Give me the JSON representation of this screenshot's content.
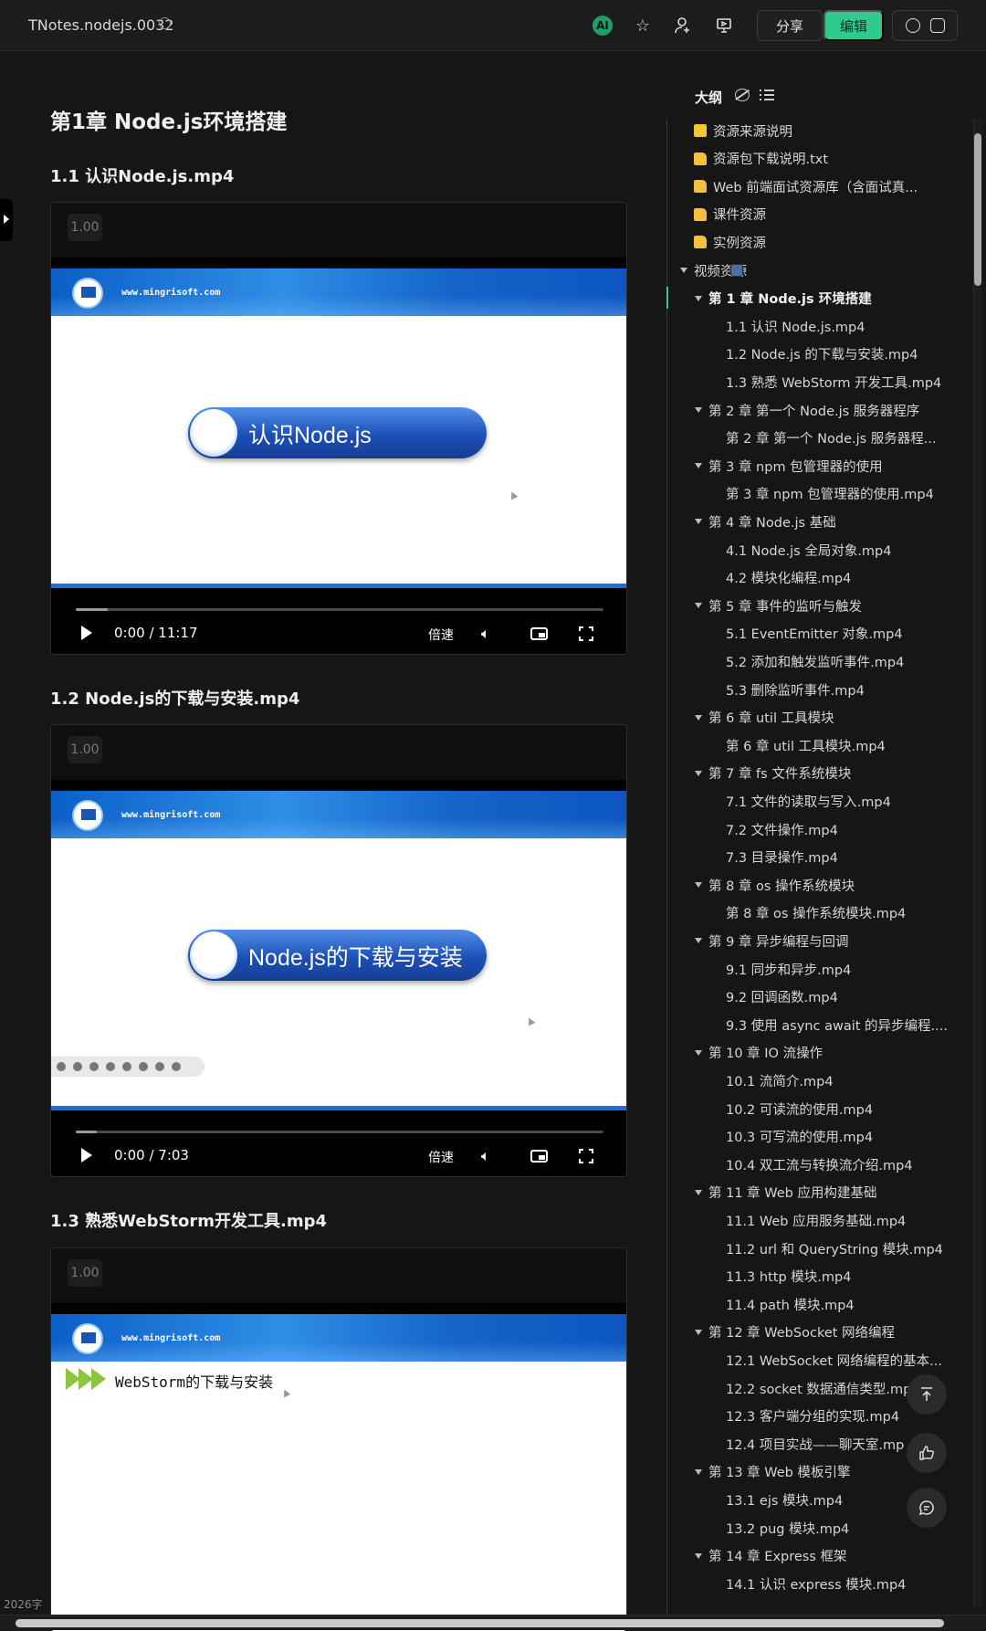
{
  "header": {
    "doc_title": "TNotes.nodejs.0032",
    "ai_label": "AI",
    "share_label": "分享",
    "edit_label": "编辑"
  },
  "doc": {
    "chapter_title": "第1章  Node.js环境搭建",
    "sections": [
      {
        "heading": "1.1  认识Node.js.mp4",
        "speed_value": "1.00",
        "site_text": "www.mingrisoft.com",
        "slide_title": "认识Node.js",
        "time": "0:00 / 11:17",
        "progress_fraction": 0.06,
        "speed_button": "倍速"
      },
      {
        "heading": "1.2  Node.js的下载与安装.mp4",
        "speed_value": "1.00",
        "site_text": "www.mingrisoft.com",
        "slide_title": "Node.js的下载与安装",
        "time": "0:00 / 7:03",
        "progress_fraction": 0.04,
        "speed_button": "倍速"
      },
      {
        "heading": "1.3  熟悉WebStorm开发工具.mp4",
        "speed_value": "1.00",
        "site_text": "www.mingrisoft.com",
        "slide_title": "WebStorm的下载与安装"
      }
    ],
    "word_count": "2026字"
  },
  "outline": {
    "title": "大纲",
    "items": [
      {
        "label": "资源来源说明",
        "level": 0,
        "icon": "note-icon",
        "caret": false
      },
      {
        "label": "资源包下载说明.txt",
        "level": 0,
        "icon": "folder-icon",
        "caret": false
      },
      {
        "label": "Web 前端面试资源库（含面试真...",
        "level": 0,
        "icon": "folder-icon",
        "caret": false
      },
      {
        "label": "课件资源",
        "level": 0,
        "icon": "folder-icon",
        "caret": false
      },
      {
        "label": "实例资源",
        "level": 0,
        "icon": "folder-icon",
        "caret": false
      },
      {
        "label": "视频资源",
        "level": 0,
        "icon": "video-icon",
        "caret": true
      },
      {
        "label": "第 1 章  Node.js 环境搭建",
        "level": 1,
        "caret": true,
        "bold": true
      },
      {
        "label": "1.1  认识 Node.js.mp4",
        "level": 2
      },
      {
        "label": "1.2  Node.js 的下载与安装.mp4",
        "level": 2
      },
      {
        "label": "1.3  熟悉 WebStorm 开发工具.mp4",
        "level": 2
      },
      {
        "label": "第 2 章  第一个 Node.js 服务器程序",
        "level": 1,
        "caret": true
      },
      {
        "label": "第 2 章  第一个 Node.js 服务器程...",
        "level": 2
      },
      {
        "label": "第 3 章  npm 包管理器的使用",
        "level": 1,
        "caret": true
      },
      {
        "label": "第 3 章  npm 包管理器的使用.mp4",
        "level": 2
      },
      {
        "label": "第 4 章  Node.js 基础",
        "level": 1,
        "caret": true
      },
      {
        "label": "4.1  Node.js 全局对象.mp4",
        "level": 2
      },
      {
        "label": "4.2  模块化编程.mp4",
        "level": 2
      },
      {
        "label": "第 5 章  事件的监听与触发",
        "level": 1,
        "caret": true
      },
      {
        "label": "5.1  EventEmitter 对象.mp4",
        "level": 2
      },
      {
        "label": "5.2  添加和触发监听事件.mp4",
        "level": 2
      },
      {
        "label": "5.3  删除监听事件.mp4",
        "level": 2
      },
      {
        "label": "第 6 章  util 工具模块",
        "level": 1,
        "caret": true
      },
      {
        "label": "第 6 章  util 工具模块.mp4",
        "level": 2
      },
      {
        "label": "第 7 章  fs 文件系统模块",
        "level": 1,
        "caret": true
      },
      {
        "label": "7.1  文件的读取与写入.mp4",
        "level": 2
      },
      {
        "label": "7.2  文件操作.mp4",
        "level": 2
      },
      {
        "label": "7.3  目录操作.mp4",
        "level": 2
      },
      {
        "label": "第 8 章  os 操作系统模块",
        "level": 1,
        "caret": true
      },
      {
        "label": "第 8 章  os 操作系统模块.mp4",
        "level": 2
      },
      {
        "label": "第 9 章  异步编程与回调",
        "level": 1,
        "caret": true
      },
      {
        "label": "9.1  同步和异步.mp4",
        "level": 2
      },
      {
        "label": "9.2  回调函数.mp4",
        "level": 2
      },
      {
        "label": "9.3  使用 async await 的异步编程....",
        "level": 2
      },
      {
        "label": "第 10 章  IO 流操作",
        "level": 1,
        "caret": true
      },
      {
        "label": "10.1  流简介.mp4",
        "level": 2
      },
      {
        "label": "10.2  可读流的使用.mp4",
        "level": 2
      },
      {
        "label": "10.3  可写流的使用.mp4",
        "level": 2
      },
      {
        "label": "10.4  双工流与转换流介绍.mp4",
        "level": 2
      },
      {
        "label": "第 11 章  Web 应用构建基础",
        "level": 1,
        "caret": true
      },
      {
        "label": "11.1  Web 应用服务基础.mp4",
        "level": 2
      },
      {
        "label": "11.2  url 和 QueryString 模块.mp4",
        "level": 2
      },
      {
        "label": "11.3  http 模块.mp4",
        "level": 2
      },
      {
        "label": "11.4  path 模块.mp4",
        "level": 2
      },
      {
        "label": "第 12 章  WebSocket 网络编程",
        "level": 1,
        "caret": true
      },
      {
        "label": "12.1  WebSocket 网络编程的基本...",
        "level": 2
      },
      {
        "label": "12.2  socket 数据通信类型.mp",
        "level": 2
      },
      {
        "label": "12.3  客户端分组的实现.mp4",
        "level": 2
      },
      {
        "label": "12.4  项目实战——聊天室.mp",
        "level": 2
      },
      {
        "label": "第 13 章  Web 模板引擎",
        "level": 1,
        "caret": true
      },
      {
        "label": "13.1  ejs 模块.mp4",
        "level": 2
      },
      {
        "label": "13.2  pug 模块.mp4",
        "level": 2
      },
      {
        "label": "第 14 章  Express 框架",
        "level": 1,
        "caret": true
      },
      {
        "label": "14.1  认识 express 模块.mp4",
        "level": 2
      }
    ]
  },
  "colors": {
    "accent": "#2ecb8d",
    "background": "#161616",
    "banner_blue": "#1464c9"
  }
}
